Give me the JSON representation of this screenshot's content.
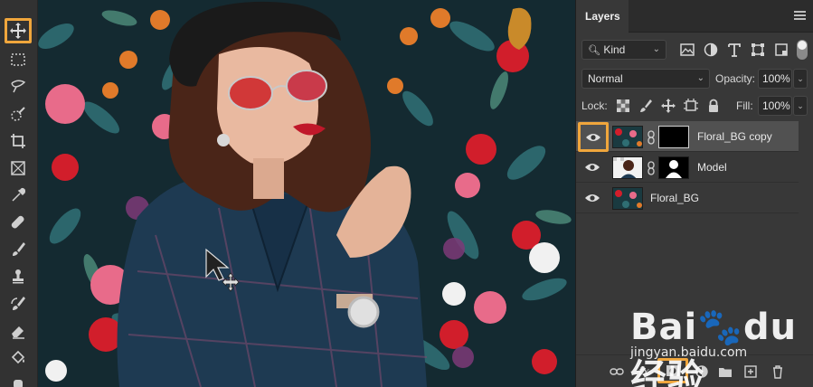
{
  "toolbar": {
    "tools": [
      {
        "name": "move-tool",
        "selected": true
      },
      {
        "name": "marquee-tool"
      },
      {
        "name": "lasso-tool"
      },
      {
        "name": "quick-selection-tool"
      },
      {
        "name": "crop-tool"
      },
      {
        "name": "frame-tool"
      },
      {
        "name": "eyedropper-tool"
      },
      {
        "name": "healing-brush-tool"
      },
      {
        "name": "brush-tool"
      },
      {
        "name": "clone-stamp-tool"
      },
      {
        "name": "history-brush-tool"
      },
      {
        "name": "eraser-tool"
      },
      {
        "name": "paint-bucket-tool"
      }
    ],
    "selected_highlight_color": "#f0a63c"
  },
  "canvas": {
    "description_colors": {
      "background": "#142a31",
      "flower_red": "#d11e2b",
      "flower_pink": "#e86b8a",
      "leaf_teal": "#2f6e73",
      "jacket": "#1e3a52"
    }
  },
  "layers_panel": {
    "tab_label": "Layers",
    "filter": {
      "kind_label": "Kind",
      "icons": [
        "image-filter-icon",
        "adjustment-filter-icon",
        "type-filter-icon",
        "shape-filter-icon",
        "smart-object-filter-icon"
      ]
    },
    "blend_mode": "Normal",
    "opacity_label": "Opacity:",
    "opacity_value": "100%",
    "lock_label": "Lock:",
    "fill_label": "Fill:",
    "fill_value": "100%",
    "layers": [
      {
        "name": "Floral_BG copy",
        "visible": true,
        "selected": true,
        "has_mask": true,
        "mask": "black"
      },
      {
        "name": "Model",
        "visible": true,
        "selected": false,
        "has_mask": true,
        "mask": "silhouette"
      },
      {
        "name": "Floral_BG",
        "visible": true,
        "selected": false,
        "has_mask": false
      }
    ],
    "footer_icons": [
      "link-layers-icon",
      "fx",
      "add-mask-icon",
      "adjustment-layer-icon",
      "new-group-icon",
      "new-layer-icon",
      "delete-layer-icon"
    ],
    "fx_label": "fx"
  },
  "watermark": {
    "brand": "Bai🐾du 经验",
    "url": "jingyan.baidu.com"
  }
}
